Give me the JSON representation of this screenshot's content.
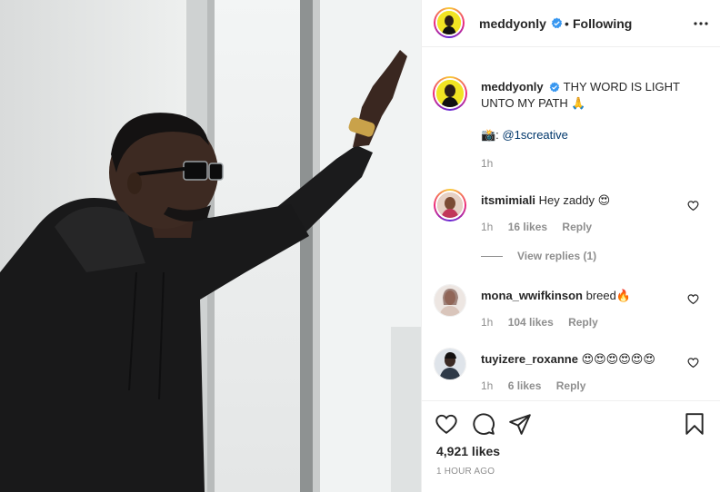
{
  "post": {
    "author": {
      "username": "meddyonly",
      "verified": true,
      "follow_state": "Following",
      "separator": "•"
    },
    "caption": {
      "username": "meddyonly",
      "text": "THY WORD IS LIGHT UNTO MY PATH 🙏",
      "credit_prefix": "📸:",
      "credit_handle": "@1screative",
      "time": "1h"
    },
    "comments": [
      {
        "username": "itsmimiali",
        "text": "Hey zaddy 😍",
        "time": "1h",
        "likes": "16 likes",
        "reply": "Reply"
      },
      {
        "username": "mona_wwifkinson",
        "text": "breed🔥",
        "time": "1h",
        "likes": "104 likes",
        "reply": "Reply"
      },
      {
        "username": "tuyizere_roxanne",
        "text": "😍😍😍😍😍😍",
        "time": "1h",
        "likes": "6 likes",
        "reply": "Reply"
      }
    ],
    "view_replies": "View replies (1)",
    "likes_count": "4,921 likes",
    "posted_ago": "1 HOUR AGO",
    "icons": [
      "more-options-icon",
      "heart-icon",
      "comment-icon",
      "share-icon",
      "bookmark-icon",
      "verified-badge-icon"
    ],
    "colors": {
      "verified_blue": "#3897f0",
      "link": "#00376b",
      "muted": "#8e8e8e",
      "text": "#262626",
      "border": "#efefef"
    }
  }
}
